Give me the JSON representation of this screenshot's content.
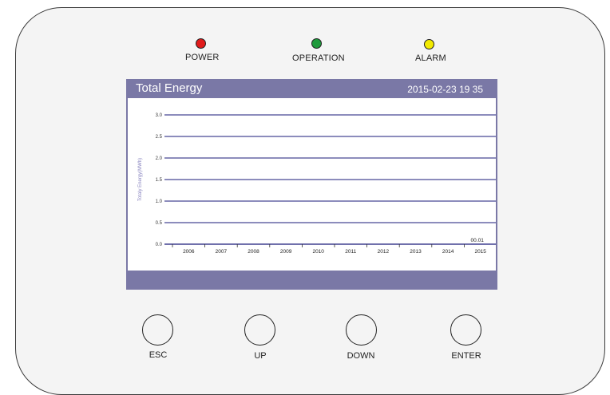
{
  "indicators": {
    "power": {
      "label": "POWER",
      "color": "#e01b1b"
    },
    "operation": {
      "label": "OPERATION",
      "color": "#1f9a3c"
    },
    "alarm": {
      "label": "ALARM",
      "color": "#f2ea00"
    }
  },
  "screen": {
    "title": "Total Energy",
    "datetime": "2015-02-23   19 35",
    "background": "#7a78a6"
  },
  "chart_data": {
    "type": "bar",
    "ylabel": "Totaly Energy(MWh)",
    "categories": [
      "2006",
      "2007",
      "2008",
      "2009",
      "2010",
      "2011",
      "2012",
      "2013",
      "2014",
      "2015"
    ],
    "values": [
      0,
      0,
      0,
      0,
      0,
      0,
      0,
      0,
      0,
      0.01
    ],
    "ylim": [
      0,
      3.0
    ],
    "yticks": [
      "0.0",
      "0.5",
      "1.0",
      "1.5",
      "2.0",
      "2.5",
      "3.0"
    ],
    "data_labels": [
      {
        "category": "2015",
        "text": "00.01"
      }
    ],
    "grid": true,
    "line_color": "#1a1a7a"
  },
  "buttons": {
    "esc": "ESC",
    "up": "UP",
    "down": "DOWN",
    "enter": "ENTER"
  }
}
